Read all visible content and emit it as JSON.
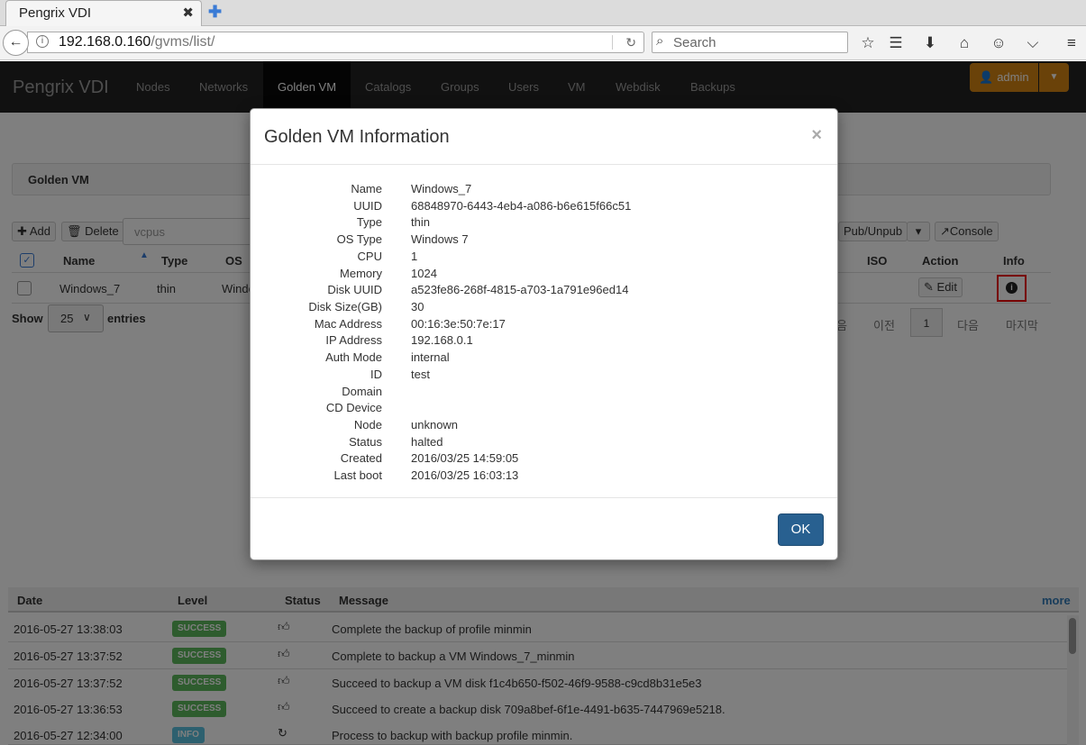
{
  "browser": {
    "tab_title": "Pengrix VDI",
    "tab_close": "✖",
    "new_tab": "✚",
    "url_host": "192.168.0.160",
    "url_path": "/gvms/list/",
    "search_placeholder": "Search"
  },
  "app": {
    "brand": "Pengrix VDI",
    "nav": [
      "Nodes",
      "Networks",
      "Golden VM",
      "Catalogs",
      "Groups",
      "Users",
      "VM",
      "Webdisk",
      "Backups"
    ],
    "active_nav": "Golden VM",
    "user": "admin"
  },
  "panel": {
    "title": "Golden VM",
    "add_label": "Add",
    "delete_label": "Delete",
    "search_value": "vcpus",
    "pub_label": "Pub/Unpub",
    "console_label": "Console"
  },
  "table": {
    "headers": [
      "Name",
      "Type",
      "OS",
      "ISO",
      "Action",
      "Info"
    ],
    "row": {
      "name": "Windows_7",
      "type": "thin",
      "os": "Windo",
      "edit_label": "Edit"
    }
  },
  "show": {
    "label": "Show",
    "value": "25",
    "suffix": "entries"
  },
  "pager": {
    "first": "음",
    "prev": "이전",
    "current": "1",
    "next": "다음",
    "last": "마지막"
  },
  "log": {
    "headers": [
      "Date",
      "Level",
      "Status",
      "Message"
    ],
    "more": "more",
    "rows": [
      {
        "date": "2016-05-27 13:38:03",
        "level": "SUCCESS",
        "message": "Complete the backup of profile minmin"
      },
      {
        "date": "2016-05-27 13:37:52",
        "level": "SUCCESS",
        "message": "Complete to backup a VM Windows_7_minmin"
      },
      {
        "date": "2016-05-27 13:37:52",
        "level": "SUCCESS",
        "message": "Succeed to backup a VM disk f1c4b650-f502-46f9-9588-c9cd8b31e5e3"
      },
      {
        "date": "2016-05-27 13:36:53",
        "level": "SUCCESS",
        "message": "Succeed to create a backup disk 709a8bef-6f1e-4491-b635-7447969e5218."
      },
      {
        "date": "2016-05-27 12:34:00",
        "level": "INFO",
        "message": "Process to backup with backup profile minmin."
      }
    ],
    "colors": {
      "success": "#5cb85c",
      "info": "#5bc0de"
    }
  },
  "modal": {
    "title": "Golden VM Information",
    "close": "×",
    "ok_label": "OK",
    "fields": [
      {
        "label": "Name",
        "value": "Windows_7"
      },
      {
        "label": "UUID",
        "value": "68848970-6443-4eb4-a086-b6e615f66c51"
      },
      {
        "label": "Type",
        "value": "thin"
      },
      {
        "label": "OS Type",
        "value": "Windows 7"
      },
      {
        "label": "CPU",
        "value": "1"
      },
      {
        "label": "Memory",
        "value": "1024"
      },
      {
        "label": "Disk UUID",
        "value": "a523fe86-268f-4815-a703-1a791e96ed14"
      },
      {
        "label": "Disk Size(GB)",
        "value": "30"
      },
      {
        "label": "Mac Address",
        "value": "00:16:3e:50:7e:17"
      },
      {
        "label": "IP Address",
        "value": "192.168.0.1"
      },
      {
        "label": "Auth Mode",
        "value": "internal"
      },
      {
        "label": "ID",
        "value": "test"
      },
      {
        "label": "Domain",
        "value": ""
      },
      {
        "label": "CD Device",
        "value": ""
      },
      {
        "label": "Node",
        "value": "unknown"
      },
      {
        "label": "Status",
        "value": "halted"
      },
      {
        "label": "Created",
        "value": "2016/03/25 14:59:05"
      },
      {
        "label": "Last boot",
        "value": "2016/03/25 16:03:13"
      }
    ]
  }
}
